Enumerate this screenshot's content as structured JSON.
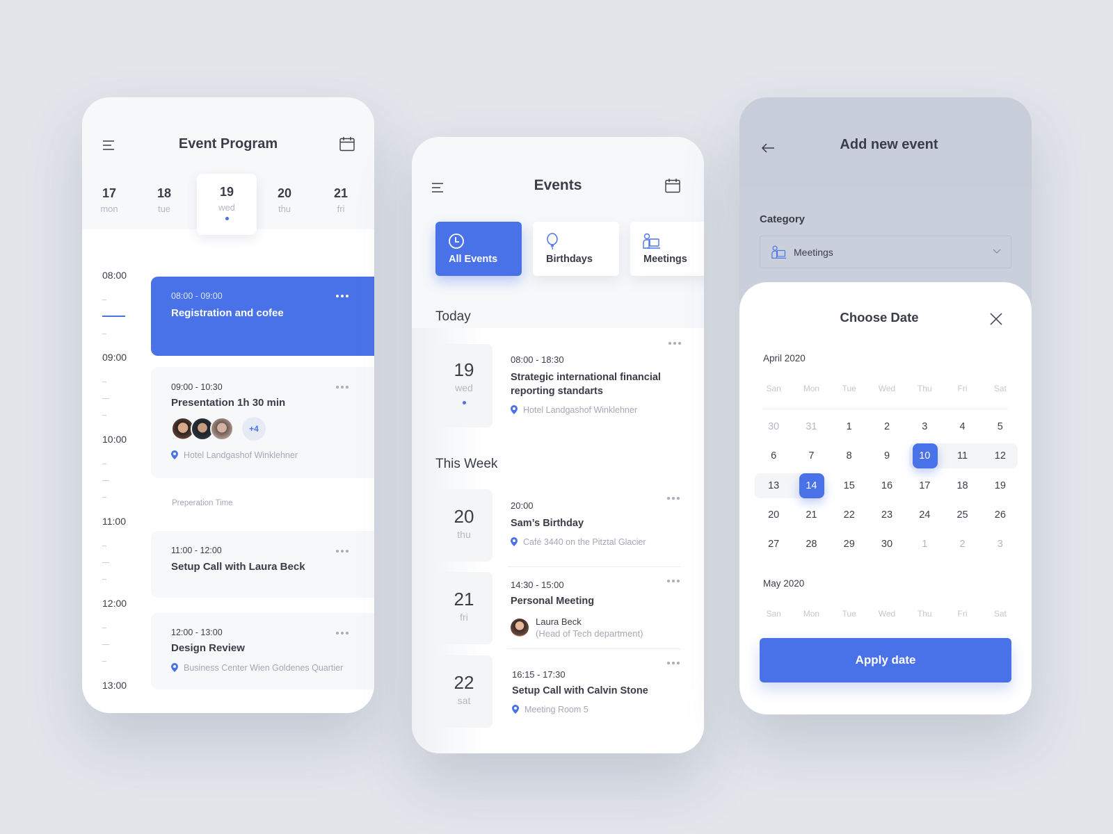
{
  "colors": {
    "accent": "#4a72e8",
    "background": "#e2e5ea",
    "text": "#3a3d48",
    "muted": "#a4a8b5"
  },
  "program": {
    "title": "Event Program",
    "menu_icon": "menu-icon",
    "calendar_icon": "calendar-icon",
    "days": [
      {
        "num": "17",
        "wd": "mon"
      },
      {
        "num": "18",
        "wd": "tue"
      },
      {
        "num": "19",
        "wd": "wed",
        "selected": true
      },
      {
        "num": "20",
        "wd": "thu"
      },
      {
        "num": "21",
        "wd": "fri"
      }
    ],
    "hours": [
      "08:00",
      "09:00",
      "10:00",
      "11:00",
      "12:00",
      "13:00"
    ],
    "events": [
      {
        "time": "08:00 - 09:00",
        "name": "Registration and cofee",
        "primary": true
      },
      {
        "time": "09:00 - 10:30",
        "name": "Presentation 1h 30 min",
        "attendees_more": "+4",
        "location": "Hotel Landgashof Winklehner"
      },
      {
        "time": "11:00 - 12:00",
        "name": "Setup Call with Laura Beck"
      },
      {
        "time": "12:00 - 13:00",
        "name": "Design Review",
        "location": "Business Center Wien Goldenes Quartier"
      }
    ],
    "prep_label": "Preperation Time"
  },
  "events": {
    "title": "Events",
    "categories": [
      {
        "label": "All Events",
        "icon": "clock-icon",
        "active": true
      },
      {
        "label": "Birthdays",
        "icon": "balloon-icon"
      },
      {
        "label": "Meetings",
        "icon": "meeting-icon"
      }
    ],
    "today_label": "Today",
    "week_label": "This Week",
    "today": {
      "num": "19",
      "wd": "wed",
      "time": "08:00 - 18:30",
      "name": "Strategic international financial reporting standarts",
      "location": "Hotel Landgashof Winklehner"
    },
    "week": [
      {
        "num": "20",
        "wd": "thu",
        "time": "20:00",
        "name": "Sam’s Birthday",
        "location": "Café 3440 on the Pitztal Glacier"
      },
      {
        "num": "21",
        "wd": "fri",
        "time": "14:30 - 15:00",
        "name": "Personal Meeting",
        "person": "Laura Beck",
        "role": "(Head of Tech department)"
      },
      {
        "num": "22",
        "wd": "sat",
        "time": "16:15 - 17:30",
        "name": "Setup Call with Calvin Stone",
        "location": "Meeting Room 5"
      }
    ]
  },
  "add_event": {
    "title": "Add new event",
    "category_label": "Category",
    "category_value": "Meetings",
    "sheet_title": "Choose Date",
    "weekdays": [
      "San",
      "Mon",
      "Tue",
      "Wed",
      "Thu",
      "Fri",
      "Sat"
    ],
    "april": {
      "label": "April 2020",
      "weeks": [
        [
          "30",
          "31",
          "1",
          "2",
          "3",
          "4",
          "5"
        ],
        [
          "6",
          "7",
          "8",
          "9",
          "10",
          "11",
          "12"
        ],
        [
          "13",
          "14",
          "15",
          "16",
          "17",
          "18",
          "19"
        ],
        [
          "20",
          "21",
          "22",
          "23",
          "24",
          "25",
          "26"
        ],
        [
          "27",
          "28",
          "29",
          "30",
          "1",
          "2",
          "3"
        ]
      ],
      "range_start": "10",
      "range_end": "14"
    },
    "may": {
      "label": "May 2020"
    },
    "apply_label": "Apply date"
  }
}
